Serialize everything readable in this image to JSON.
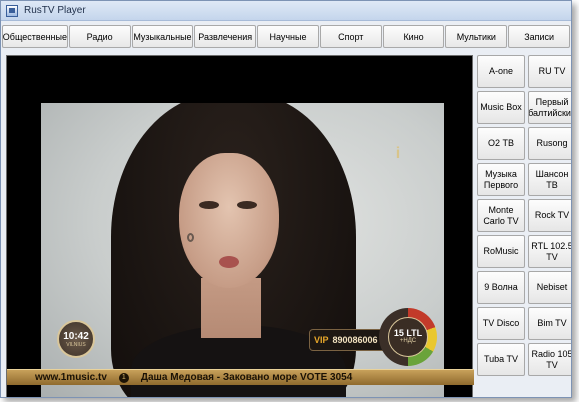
{
  "window": {
    "title": "RusTV Player"
  },
  "categories": [
    "Общественные",
    "Радио",
    "Музыкальные",
    "Развлечения",
    "Научные",
    "Спорт",
    "Кино",
    "Мультики",
    "Записи"
  ],
  "video": {
    "channel_logo": "i",
    "clock_time": "10:42",
    "clock_brand": "VILNIUS",
    "vip_label": "VIP",
    "vip_number": "890086006",
    "price_amount": "15 LTL",
    "price_vat": "+НДС",
    "ticker_url": "www.1music.tv",
    "ticker_sep": "1",
    "ticker_message": "Даша Медовая - Заковано море  VOTE 3054"
  },
  "channels": [
    "A-one",
    "RU TV",
    "Music Box",
    "Первый балтийский",
    "O2 ТВ",
    "Rusong",
    "Музыка Первого",
    "Шансон ТВ",
    "Monte Carlo TV",
    "Rock TV",
    "RoMusic",
    "RTL 102.5 TV",
    "9 Волна",
    "Nebiset",
    "TV Disco",
    "Bim TV",
    "Tuba TV",
    "Radio 105 TV"
  ]
}
